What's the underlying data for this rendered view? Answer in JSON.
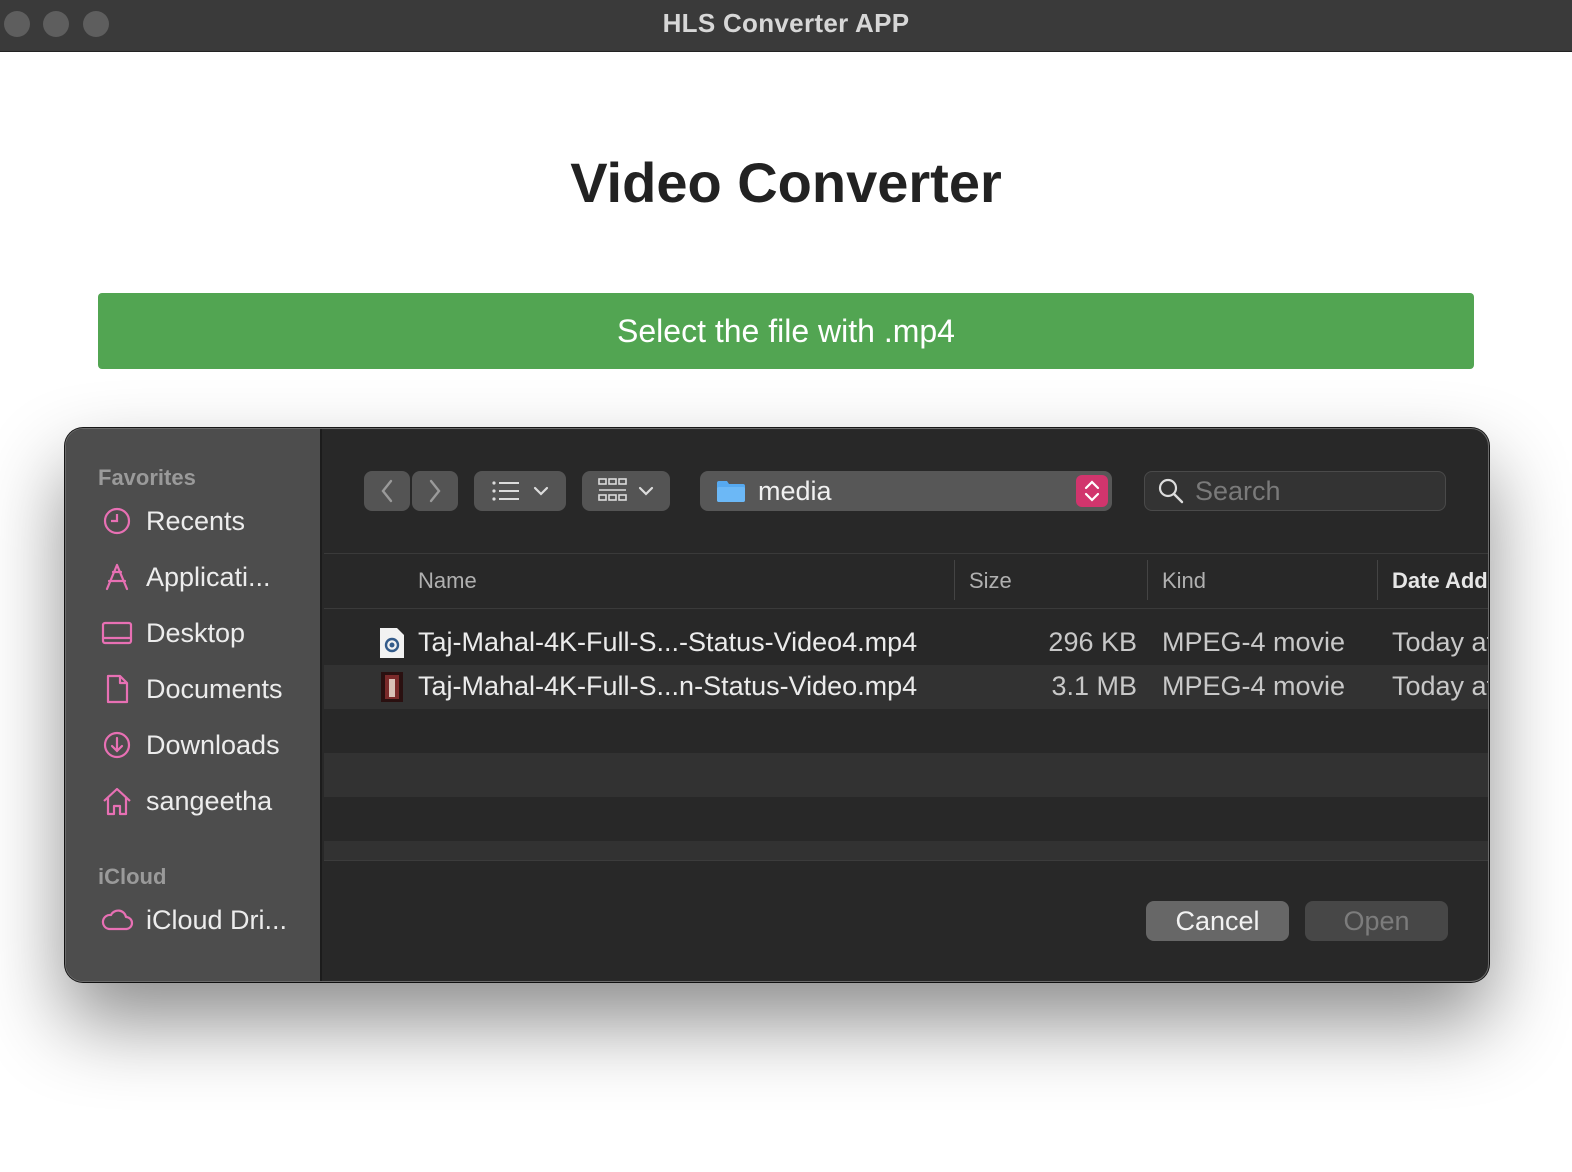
{
  "window": {
    "title": "HLS Converter APP"
  },
  "app": {
    "heading": "Video Converter",
    "select_button": "Select the file with .mp4"
  },
  "dialog": {
    "sidebar": {
      "favorites_label": "Favorites",
      "favorites": [
        {
          "label": "Recents",
          "icon": "clock-icon"
        },
        {
          "label": "Applicati...",
          "icon": "applications-icon"
        },
        {
          "label": "Desktop",
          "icon": "desktop-icon"
        },
        {
          "label": "Documents",
          "icon": "document-icon"
        },
        {
          "label": "Downloads",
          "icon": "download-icon"
        },
        {
          "label": "sangeetha",
          "icon": "home-icon"
        }
      ],
      "icloud_label": "iCloud",
      "icloud": [
        {
          "label": "iCloud Dri...",
          "icon": "cloud-icon"
        }
      ],
      "icon_color": "#e870b4"
    },
    "toolbar": {
      "location": "media",
      "search_placeholder": "Search"
    },
    "columns": [
      "Name",
      "Size",
      "Kind",
      "Date Add"
    ],
    "files": [
      {
        "name": "Taj-Mahal-4K-Full-S...-Status-Video4.mp4",
        "size": "296 KB",
        "kind": "MPEG-4 movie",
        "date": "Today at"
      },
      {
        "name": "Taj-Mahal-4K-Full-S...n-Status-Video.mp4",
        "size": "3.1 MB",
        "kind": "MPEG-4 movie",
        "date": "Today at"
      }
    ],
    "buttons": {
      "cancel": "Cancel",
      "open": "Open"
    }
  }
}
